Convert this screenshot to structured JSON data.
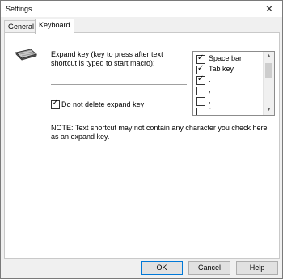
{
  "window": {
    "title": "Settings",
    "close_glyph": "✕"
  },
  "tabs": [
    {
      "label": "General"
    },
    {
      "label": "Keyboard"
    }
  ],
  "keyboard": {
    "icon": "keyboard-icon",
    "expand_label": "Expand key (key to press after text shortcut is typed to start macro):",
    "do_not_delete": {
      "label": "Do not delete expand key",
      "checked": true
    },
    "note": "NOTE:  Text shortcut may not contain any character you check here as an expand key.",
    "keys": [
      {
        "label": "Space bar",
        "checked": true
      },
      {
        "label": "Tab key",
        "checked": true
      },
      {
        "label": ".",
        "checked": true
      },
      {
        "label": ",",
        "checked": false
      },
      {
        "label": ";",
        "checked": false
      },
      {
        "label": "`",
        "checked": false
      }
    ]
  },
  "buttons": {
    "ok": "OK",
    "cancel": "Cancel",
    "help": "Help"
  }
}
